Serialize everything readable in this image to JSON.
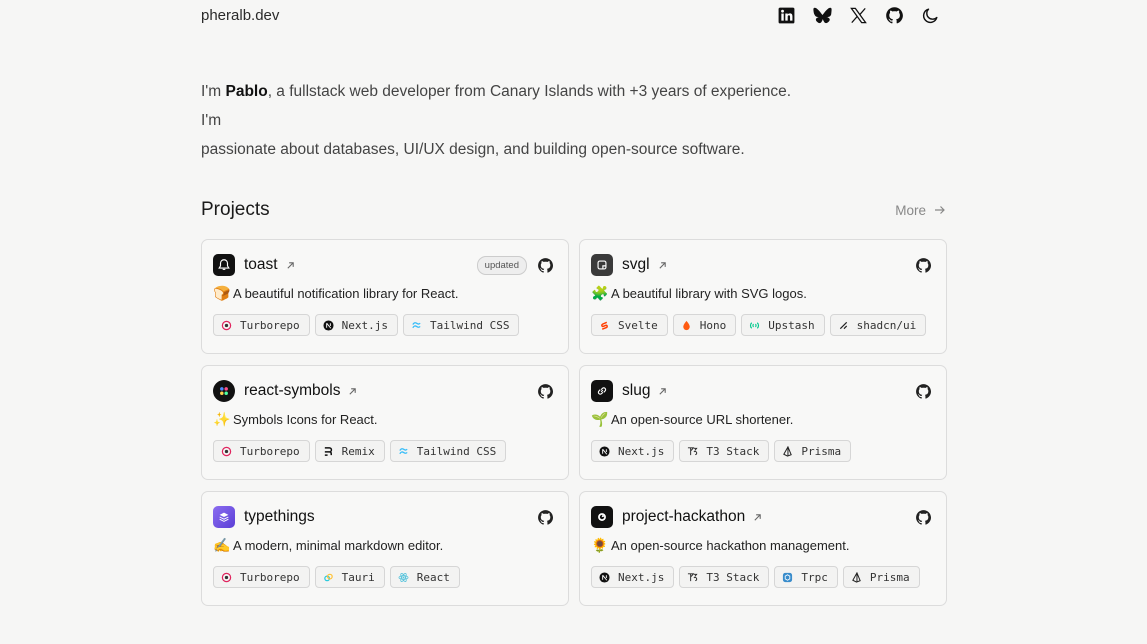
{
  "header": {
    "site_name": "pheralb.dev"
  },
  "intro": {
    "prefix": "I'm ",
    "name": "Pablo",
    "rest_line1": ", a fullstack web developer from Canary Islands with +3 years of experience. I'm",
    "line2": "passionate about databases, UI/UX design, and building open-source software."
  },
  "projects": {
    "title": "Projects",
    "more_label": "More",
    "items": [
      {
        "name": "toast",
        "badge": "updated",
        "emoji": "🍞",
        "description": "A beautiful notification library for React.",
        "tags": [
          "Turborepo",
          "Next.js",
          "Tailwind CSS"
        ]
      },
      {
        "name": "svgl",
        "badge": "",
        "emoji": "🧩",
        "description": "A beautiful library with SVG logos.",
        "tags": [
          "Svelte",
          "Hono",
          "Upstash",
          "shadcn/ui"
        ]
      },
      {
        "name": "react-symbols",
        "badge": "",
        "emoji": "✨",
        "description": "Symbols Icons for React.",
        "tags": [
          "Turborepo",
          "Remix",
          "Tailwind CSS"
        ]
      },
      {
        "name": "slug",
        "badge": "",
        "emoji": "🌱",
        "description": "An open-source URL shortener.",
        "tags": [
          "Next.js",
          "T3 Stack",
          "Prisma"
        ]
      },
      {
        "name": "typethings",
        "badge": "",
        "emoji": "✍️",
        "description": "A modern, minimal markdown editor.",
        "tags": [
          "Turborepo",
          "Tauri",
          "React"
        ]
      },
      {
        "name": "project-hackathon",
        "badge": "",
        "emoji": "🌻",
        "description": "An open-source hackathon management.",
        "tags": [
          "Next.js",
          "T3 Stack",
          "Trpc",
          "Prisma"
        ]
      }
    ]
  },
  "colors": {
    "background": "#f6f6f5",
    "card_border": "#dcdcdc",
    "text": "#1f1f1f"
  }
}
